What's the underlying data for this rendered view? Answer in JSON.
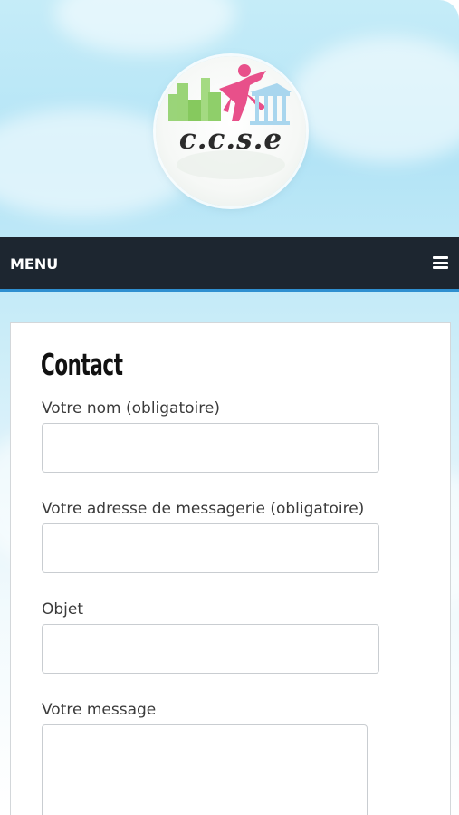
{
  "header": {
    "logo_text": "c.c.s.e"
  },
  "nav": {
    "menu_label": "MENU",
    "menu_icon": "hamburger-icon"
  },
  "form": {
    "title": "Contact",
    "fields": [
      {
        "label": "Votre nom (obligatoire)",
        "value": "",
        "placeholder": ""
      },
      {
        "label": "Votre adresse de messagerie (obligatoire)",
        "value": "",
        "placeholder": ""
      },
      {
        "label": "Objet",
        "value": "",
        "placeholder": ""
      },
      {
        "label": "Votre message",
        "value": "",
        "placeholder": ""
      }
    ]
  },
  "colors": {
    "nav_background": "#1d2630",
    "nav_accent": "#2f8fd0",
    "logo_pink": "#e8508a",
    "logo_green": "#8fcf6a",
    "logo_blue": "#a9d6ee"
  }
}
